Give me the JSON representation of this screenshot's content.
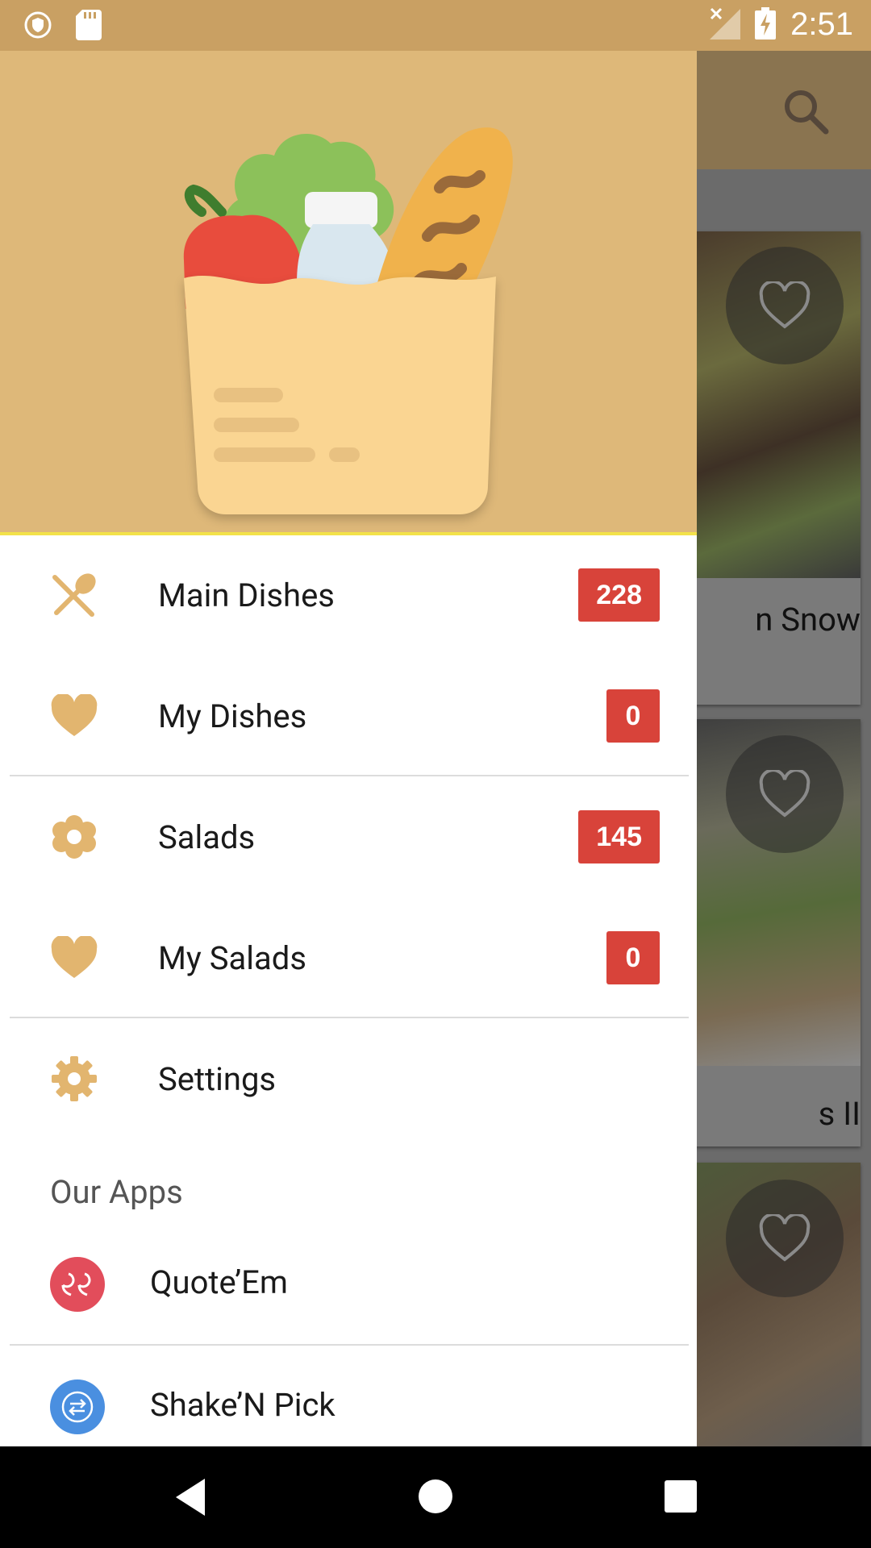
{
  "status_bar": {
    "time": "2:51",
    "icons": [
      "shield-icon",
      "sd-card-icon",
      "no-signal-icon",
      "battery-charging-icon"
    ]
  },
  "background": {
    "search_icon": "search-icon",
    "cards": [
      {
        "caption": "n Snow"
      },
      {
        "caption": "s II"
      },
      {
        "caption": ""
      }
    ]
  },
  "drawer": {
    "header_image": "grocery-bag-illustration",
    "menu": [
      {
        "label": "Main Dishes",
        "badge": "228",
        "icon": "fork-spoon-icon"
      },
      {
        "label": "My Dishes",
        "badge": "0",
        "icon": "heart-icon"
      },
      {
        "label": "Salads",
        "badge": "145",
        "icon": "flower-icon"
      },
      {
        "label": "My Salads",
        "badge": "0",
        "icon": "heart-icon"
      },
      {
        "label": "Settings",
        "icon": "gear-icon"
      }
    ],
    "our_apps_label": "Our Apps",
    "apps": [
      {
        "label": "Quote’Em",
        "icon": "quote-icon",
        "color": "#e24d5b"
      },
      {
        "label": "Shake’N Pick",
        "icon": "arrows-icon",
        "color": "#4a8fe0"
      }
    ]
  },
  "colors": {
    "accent": "#deb879",
    "icon_tint": "#e2b56f",
    "badge": "#d8433a"
  }
}
